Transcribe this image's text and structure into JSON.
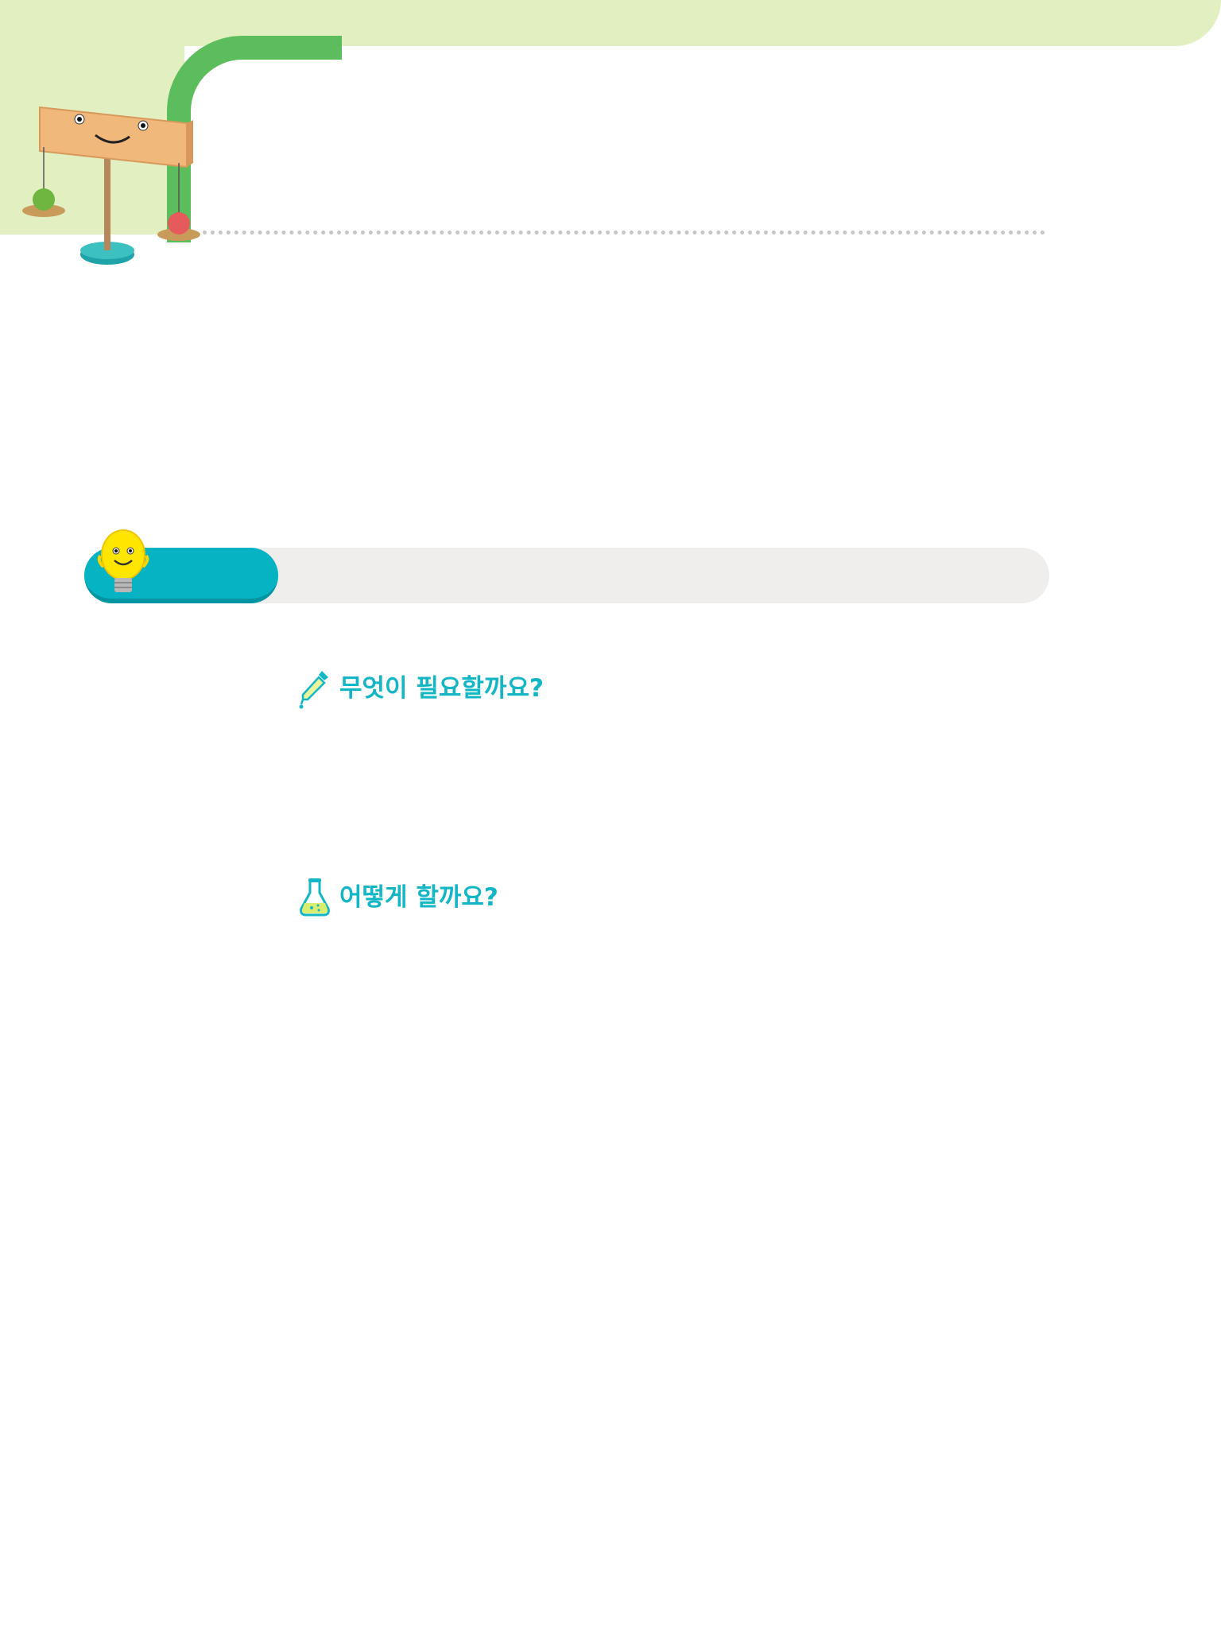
{
  "colors": {
    "header_background": "#e1efc1",
    "accent_green": "#5cbd5d",
    "accent_teal": "#06b3c2",
    "bar_gray": "#f0eeed",
    "heading_text": "#12b6c5"
  },
  "icons": {
    "mascot": "balance-scale-mascot",
    "section": "lightbulb-mascot",
    "materials": "dropper-icon",
    "procedure": "flask-icon"
  },
  "materials_heading": "무엇이 필요할까요?",
  "procedure_heading": "어떻게 할까요?"
}
